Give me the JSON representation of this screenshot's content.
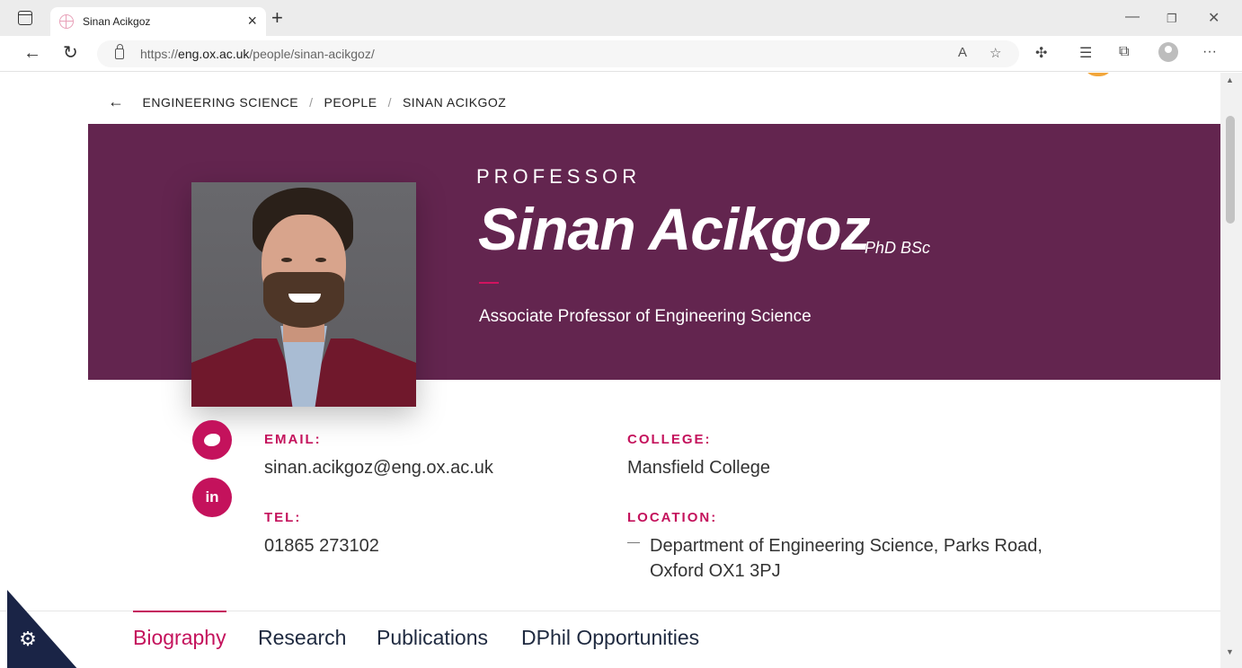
{
  "browser": {
    "tab_title": "Sinan Acikgoz",
    "url_scheme": "https://",
    "url_host": "eng.ox.ac.uk",
    "url_path": "/people/sinan-acikgoz/"
  },
  "breadcrumb": {
    "items": [
      "ENGINEERING SCIENCE",
      "PEOPLE",
      "SINAN ACIKGOZ"
    ]
  },
  "profile": {
    "label": "PROFESSOR",
    "name": "Sinan Acikgoz",
    "degrees": "PhD BSc",
    "job_title": "Associate Professor of Engineering Science"
  },
  "contact": {
    "email_label": "EMAIL:",
    "email": "sinan.acikgoz@eng.ox.ac.uk",
    "tel_label": "TEL:",
    "tel": "01865 273102",
    "college_label": "COLLEGE:",
    "college": "Mansfield College",
    "location_label": "LOCATION:",
    "location_line1": "Department of Engineering Science, Parks Road,",
    "location_line2": "Oxford OX1 3PJ"
  },
  "social": {
    "linkedin_label": "in"
  },
  "tabs": [
    "Biography",
    "Research",
    "Publications",
    "DPhil Opportunities"
  ],
  "colors": {
    "hero": "#63254f",
    "accent": "#c4125c",
    "cookie_banner": "#1a2446"
  }
}
